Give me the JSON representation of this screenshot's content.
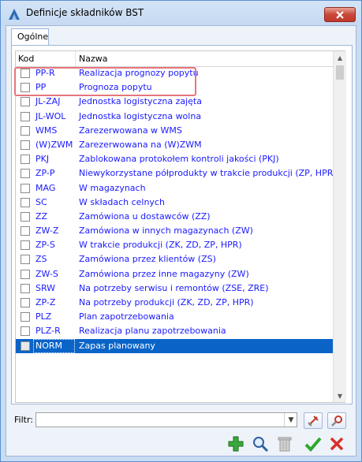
{
  "window": {
    "title": "Definicje składników BST"
  },
  "tabs": [
    {
      "label": "Ogólne"
    }
  ],
  "table": {
    "columns": {
      "kod": "Kod",
      "nazwa": "Nazwa"
    },
    "rows": [
      {
        "kod": "PP-R",
        "nazwa": "Realizacja prognozy popytu",
        "checked": false,
        "selected": false
      },
      {
        "kod": "PP",
        "nazwa": "Prognoza popytu",
        "checked": false,
        "selected": false
      },
      {
        "kod": "JL-ZAJ",
        "nazwa": "Jednostka logistyczna zajęta",
        "checked": false,
        "selected": false
      },
      {
        "kod": "JL-WOL",
        "nazwa": "Jednostka logistyczna wolna",
        "checked": false,
        "selected": false
      },
      {
        "kod": "WMS",
        "nazwa": "Zarezerwowana w WMS",
        "checked": false,
        "selected": false
      },
      {
        "kod": "(W)ZWM",
        "nazwa": "Zarezerwowana na (W)ZWM",
        "checked": false,
        "selected": false
      },
      {
        "kod": "PKJ",
        "nazwa": "Zablokowana protokołem kontroli jakości (PKJ)",
        "checked": false,
        "selected": false
      },
      {
        "kod": "ZP-P",
        "nazwa": "Niewykorzystane półprodukty w trakcie produkcji (ZP, HPR)",
        "checked": false,
        "selected": false
      },
      {
        "kod": "MAG",
        "nazwa": "W magazynach",
        "checked": false,
        "selected": false
      },
      {
        "kod": "SC",
        "nazwa": "W składach celnych",
        "checked": false,
        "selected": false
      },
      {
        "kod": "ZZ",
        "nazwa": "Zamówiona u dostawców (ZZ)",
        "checked": false,
        "selected": false
      },
      {
        "kod": "ZW-Z",
        "nazwa": "Zamówiona w innych magazynach (ZW)",
        "checked": false,
        "selected": false
      },
      {
        "kod": "ZP-S",
        "nazwa": "W trakcie produkcji (ZK, ZD, ZP, HPR)",
        "checked": false,
        "selected": false
      },
      {
        "kod": "ZS",
        "nazwa": "Zamówiona przez klientów (ZS)",
        "checked": false,
        "selected": false
      },
      {
        "kod": "ZW-S",
        "nazwa": "Zamówiona przez inne magazyny (ZW)",
        "checked": false,
        "selected": false
      },
      {
        "kod": "SRW",
        "nazwa": "Na potrzeby serwisu i remontów (ZSE, ZRE)",
        "checked": false,
        "selected": false
      },
      {
        "kod": "ZP-Z",
        "nazwa": "Na potrzeby produkcji (ZK, ZD, ZP, HPR)",
        "checked": false,
        "selected": false
      },
      {
        "kod": "PLZ",
        "nazwa": "Plan zapotrzebowania",
        "checked": false,
        "selected": false
      },
      {
        "kod": "PLZ-R",
        "nazwa": "Realizacja planu zapotrzebowania",
        "checked": false,
        "selected": false
      },
      {
        "kod": "NORM",
        "nazwa": "Zapas planowany",
        "checked": false,
        "selected": true
      }
    ]
  },
  "filter": {
    "label": "Filtr:",
    "value": ""
  },
  "icons": {
    "app": "app-logo-icon",
    "close": "close-icon",
    "clear_filter": "clear-filter-icon",
    "build_filter": "build-filter-icon",
    "add": "add-icon",
    "preview": "preview-magnifier-icon",
    "delete": "delete-trash-icon",
    "confirm": "confirm-check-icon",
    "cancel": "cancel-x-icon"
  },
  "colors": {
    "selection": "#0a64c8",
    "row_text": "#1a1aff",
    "highlight_box": "#e5767c",
    "close_button": "#c9473a"
  }
}
